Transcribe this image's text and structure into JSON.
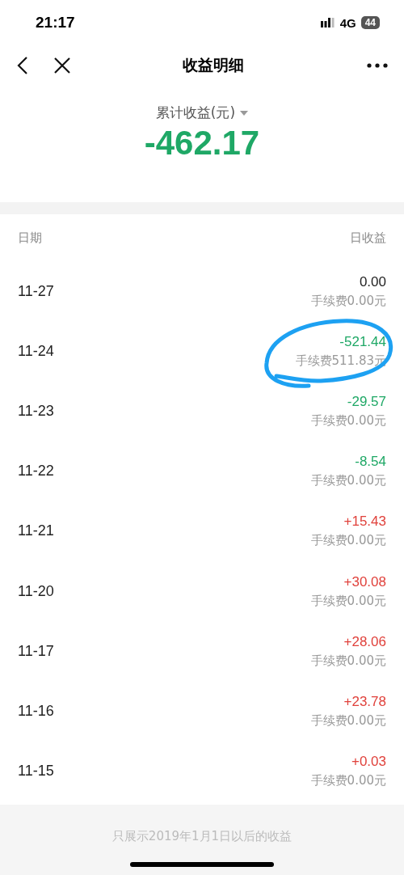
{
  "status_bar": {
    "time": "21:17",
    "network": "4G",
    "battery": "44"
  },
  "nav": {
    "title": "收益明细"
  },
  "summary": {
    "label": "累计收益(元)",
    "total": "-462.17"
  },
  "table": {
    "columns": [
      "日期",
      "日收益"
    ],
    "rows": [
      {
        "date": "11-27",
        "amount": "0.00",
        "fee": "手续费0.00元",
        "color": "#222222",
        "circled": false
      },
      {
        "date": "11-24",
        "amount": "-521.44",
        "fee": "手续费511.83元",
        "color": "#1fa866",
        "circled": true
      },
      {
        "date": "11-23",
        "amount": "-29.57",
        "fee": "手续费0.00元",
        "color": "#1fa866",
        "circled": false
      },
      {
        "date": "11-22",
        "amount": "-8.54",
        "fee": "手续费0.00元",
        "color": "#1fa866",
        "circled": false
      },
      {
        "date": "11-21",
        "amount": "+15.43",
        "fee": "手续费0.00元",
        "color": "#e0413b",
        "circled": false
      },
      {
        "date": "11-20",
        "amount": "+30.08",
        "fee": "手续费0.00元",
        "color": "#e0413b",
        "circled": false
      },
      {
        "date": "11-17",
        "amount": "+28.06",
        "fee": "手续费0.00元",
        "color": "#e0413b",
        "circled": false
      },
      {
        "date": "11-16",
        "amount": "+23.78",
        "fee": "手续费0.00元",
        "color": "#e0413b",
        "circled": false
      },
      {
        "date": "11-15",
        "amount": "+0.03",
        "fee": "手续费0.00元",
        "color": "#e0413b",
        "circled": false
      }
    ]
  },
  "footer": {
    "note": "只展示2019年1月1日以后的收益"
  }
}
